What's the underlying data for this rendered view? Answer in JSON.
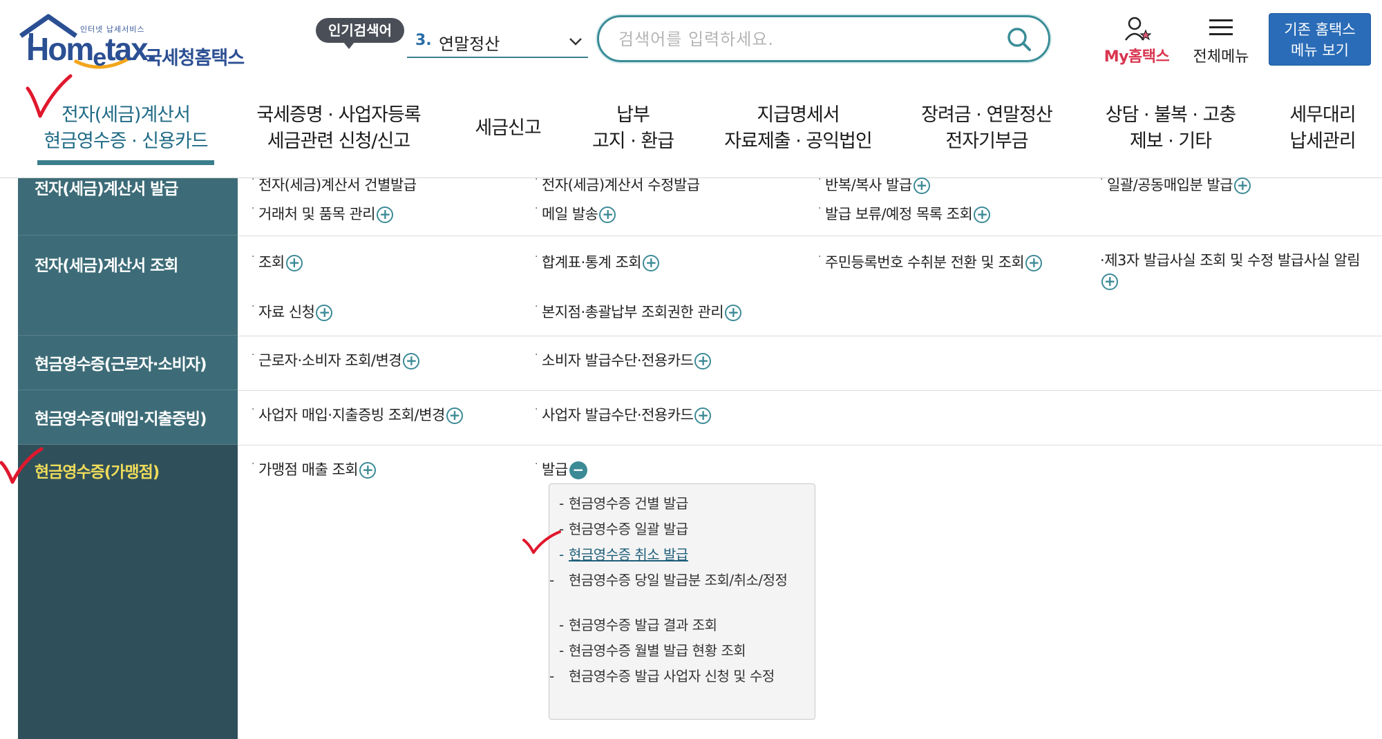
{
  "header": {
    "logo_tagline": "인터넷 납세서비스",
    "logo_word_pre": "Hom",
    "logo_word_e": "e",
    "logo_word_post": "tax.",
    "logo_korean": "국세청홈택스",
    "popular_badge": "인기검색어",
    "keyword_num": "3.",
    "keyword_text": "연말정산",
    "search_placeholder": "검색어를 입력하세요.",
    "my_hometax": "My홈택스",
    "all_menu": "전체메뉴",
    "old_menu_line1": "기존 홈택스",
    "old_menu_line2": "메뉴 보기"
  },
  "nav": {
    "items": [
      {
        "l1": "전자(세금)계산서",
        "l2": "현금영수증 · 신용카드"
      },
      {
        "l1": "국세증명 · 사업자등록",
        "l2": "세금관련 신청/신고"
      },
      {
        "l1": "세금신고",
        "l2": ""
      },
      {
        "l1": "납부",
        "l2": "고지 · 환급"
      },
      {
        "l1": "지급명세서",
        "l2": "자료제출 · 공익법인"
      },
      {
        "l1": "장려금 · 연말정산",
        "l2": "전자기부금"
      },
      {
        "l1": "상담 · 불복 · 고충",
        "l2": "제보 · 기타"
      },
      {
        "l1": "세무대리",
        "l2": "납세관리"
      }
    ]
  },
  "categories": [
    "전자(세금)계산서 발급",
    "전자(세금)계산서 조회",
    "현금영수증(근로자·소비자)",
    "현금영수증(매입·지출증빙)",
    "현금영수증(가맹점)"
  ],
  "links": {
    "issue_row1": [
      "전자(세금)계산서 건별발급",
      "전자(세금)계산서 수정발급",
      "반복/복사 발급",
      "일괄/공동매입분 발급"
    ],
    "issue_row2": [
      "거래처 및 품목 관리",
      "메일 발송",
      "발급 보류/예정 목록 조회"
    ],
    "query_row1": [
      "조회",
      "합계표·통계 조회",
      "주민등록번호 수취분 전환 및 조회",
      "제3자 발급사실 조회 및 수정 발급사실 알림"
    ],
    "query_row2": [
      "자료 신청",
      "본지점·총괄납부 조회권한 관리"
    ],
    "worker": [
      "근로자·소비자 조회/변경",
      "소비자 발급수단·전용카드"
    ],
    "business": [
      "사업자 매입·지출증빙 조회/변경",
      "사업자 발급수단·전용카드"
    ],
    "merchant": [
      "가맹점 매출 조회",
      "발급"
    ]
  },
  "plus_symbol": "+",
  "minus_symbol": "−",
  "bullet": "·",
  "dash": "-",
  "sub_menu": [
    "현금영수증 건별 발급",
    "현금영수증 일괄 발급",
    "현금영수증 취소 발급",
    "현금영수증 당일 발급분 조회/취소/정정",
    "현금영수증 발급 결과 조회",
    "현금영수증 월별 발급 현황 조회",
    "현금영수증 발급 사업자 신청 및 수정"
  ],
  "colors": {
    "brand_blue": "#2b4f93",
    "teal": "#3a8c96",
    "sidebar": "#3d6c78",
    "sidebar_active": "#2f505a",
    "active_text": "#f0dc5a",
    "check_red": "#e0182d"
  }
}
